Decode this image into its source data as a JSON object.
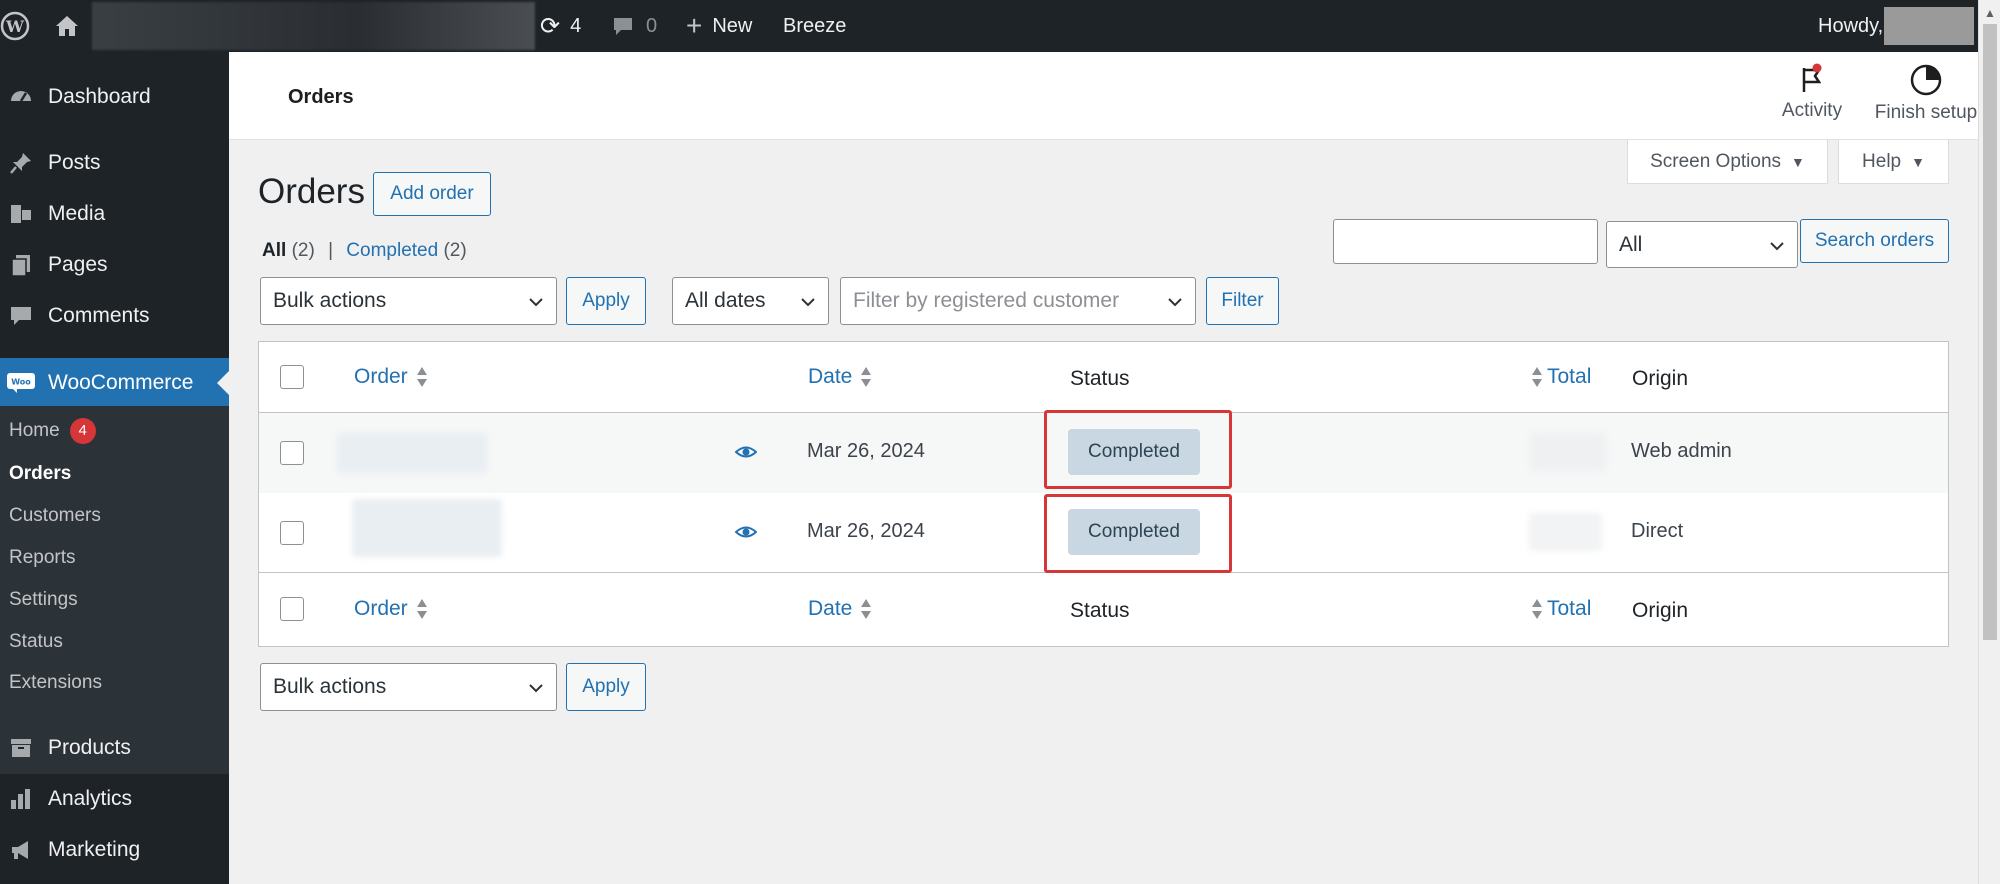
{
  "admin_bar": {
    "updates_count": "4",
    "comments_count": "0",
    "new_label": "New",
    "breeze_label": "Breeze",
    "howdy_label": "Howdy,"
  },
  "sidebar": {
    "items": [
      {
        "label": "Dashboard",
        "icon": "dashboard-icon"
      },
      {
        "label": "Posts",
        "icon": "pin-icon"
      },
      {
        "label": "Media",
        "icon": "media-icon"
      },
      {
        "label": "Pages",
        "icon": "pages-icon"
      },
      {
        "label": "Comments",
        "icon": "comment-icon"
      },
      {
        "label": "WooCommerce",
        "icon": "woo-icon"
      },
      {
        "label": "Products",
        "icon": "archive-icon"
      },
      {
        "label": "Analytics",
        "icon": "bar-chart-icon"
      },
      {
        "label": "Marketing",
        "icon": "megaphone-icon"
      }
    ],
    "submenu": [
      {
        "label": "Home",
        "badge": "4"
      },
      {
        "label": "Orders"
      },
      {
        "label": "Customers"
      },
      {
        "label": "Reports"
      },
      {
        "label": "Settings"
      },
      {
        "label": "Status"
      },
      {
        "label": "Extensions"
      }
    ]
  },
  "header": {
    "title": "Orders",
    "activity_label": "Activity",
    "finish_setup_label": "Finish setup"
  },
  "tabs": {
    "screen_options": "Screen Options",
    "help": "Help"
  },
  "page": {
    "title": "Orders",
    "add_order": "Add order",
    "filters": {
      "all_label": "All",
      "all_count": "(2)",
      "separator": "|",
      "completed_label": "Completed",
      "completed_count": "(2)"
    },
    "search": {
      "status_select": "All",
      "button": "Search orders"
    },
    "bulk_actions": "Bulk actions",
    "apply": "Apply",
    "dates_select": "All dates",
    "customer_filter_placeholder": "Filter by registered customer",
    "filter_button": "Filter"
  },
  "table": {
    "columns": {
      "order": "Order",
      "date": "Date",
      "status": "Status",
      "total": "Total",
      "origin": "Origin"
    },
    "rows": [
      {
        "date": "Mar 26, 2024",
        "status": "Completed",
        "origin": "Web admin"
      },
      {
        "date": "Mar 26, 2024",
        "status": "Completed",
        "origin": "Direct"
      }
    ]
  },
  "colors": {
    "accent": "#2271b1",
    "admin_bg": "#1d2327",
    "highlight": "#d63638",
    "status_completed_bg": "#c8d7e1"
  }
}
